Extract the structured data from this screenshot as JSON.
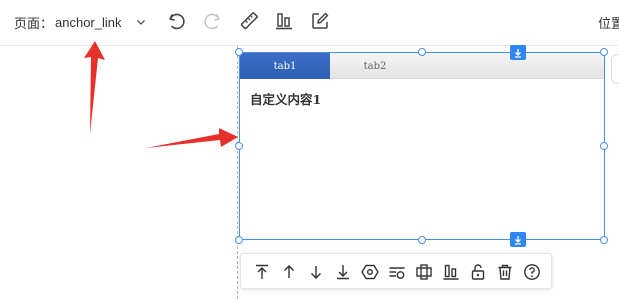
{
  "toolbar": {
    "page_label": "页面：",
    "page_value": "anchor_link",
    "position_label": "位置"
  },
  "icons": {
    "undo": "undo-icon",
    "redo": "redo-icon",
    "ruler": "ruler-icon",
    "align": "align-bottom-icon",
    "edit": "edit-icon"
  },
  "component": {
    "tabs": [
      {
        "label": "tab1",
        "active": true
      },
      {
        "label": "tab2",
        "active": false
      }
    ],
    "content": "自定义内容1"
  },
  "floating_toolbar": {
    "items": [
      "move-to-top-icon",
      "move-up-icon",
      "move-down-icon",
      "move-to-bottom-icon",
      "settings-hex-icon",
      "add-row-icon",
      "center-align-icon",
      "align-bottom-icon",
      "unlock-icon",
      "delete-icon",
      "help-icon"
    ]
  },
  "colors": {
    "accent": "#2f86f6",
    "selection": "#4a90e2",
    "tab_active": "#2c5fb4",
    "annotation_arrow": "#e8302b"
  }
}
